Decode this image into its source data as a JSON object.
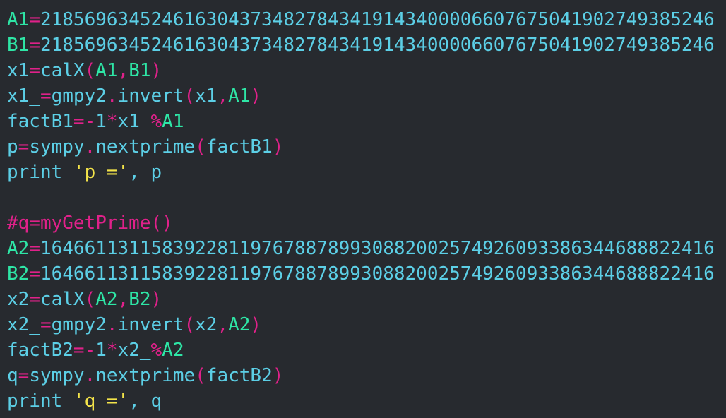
{
  "editor": {
    "lines": [
      [
        {
          "t": "A1",
          "c": "def"
        },
        {
          "t": "=",
          "c": "op"
        },
        {
          "t": "2185696345246163043734827843419143400006607675041902749385246",
          "c": "num"
        }
      ],
      [
        {
          "t": "B1",
          "c": "def"
        },
        {
          "t": "=",
          "c": "op"
        },
        {
          "t": "2185696345246163043734827843419143400006607675041902749385246",
          "c": "num"
        }
      ],
      [
        {
          "t": "x1",
          "c": "var"
        },
        {
          "t": "=",
          "c": "op"
        },
        {
          "t": "calX",
          "c": "var"
        },
        {
          "t": "(",
          "c": "op"
        },
        {
          "t": "A1",
          "c": "def"
        },
        {
          "t": ",",
          "c": "op"
        },
        {
          "t": "B1",
          "c": "def"
        },
        {
          "t": ")",
          "c": "op"
        }
      ],
      [
        {
          "t": "x1_",
          "c": "var"
        },
        {
          "t": "=",
          "c": "op"
        },
        {
          "t": "gmpy2",
          "c": "var"
        },
        {
          "t": ".",
          "c": "op"
        },
        {
          "t": "invert",
          "c": "var"
        },
        {
          "t": "(",
          "c": "op"
        },
        {
          "t": "x1",
          "c": "var"
        },
        {
          "t": ",",
          "c": "op"
        },
        {
          "t": "A1",
          "c": "def"
        },
        {
          "t": ")",
          "c": "op"
        }
      ],
      [
        {
          "t": "factB1",
          "c": "var"
        },
        {
          "t": "=-",
          "c": "op"
        },
        {
          "t": "1",
          "c": "num"
        },
        {
          "t": "*",
          "c": "op"
        },
        {
          "t": "x1_",
          "c": "var"
        },
        {
          "t": "%",
          "c": "op"
        },
        {
          "t": "A1",
          "c": "def"
        }
      ],
      [
        {
          "t": "p",
          "c": "var"
        },
        {
          "t": "=",
          "c": "op"
        },
        {
          "t": "sympy",
          "c": "var"
        },
        {
          "t": ".",
          "c": "op"
        },
        {
          "t": "nextprime",
          "c": "var"
        },
        {
          "t": "(",
          "c": "op"
        },
        {
          "t": "factB1",
          "c": "var"
        },
        {
          "t": ")",
          "c": "op"
        }
      ],
      [
        {
          "t": "print ",
          "c": "var"
        },
        {
          "t": "'p ='",
          "c": "str"
        },
        {
          "t": ", p",
          "c": "var"
        }
      ],
      [
        {
          "t": "",
          "c": "var"
        }
      ],
      [
        {
          "t": "#q=myGetPrime()",
          "c": "com"
        }
      ],
      [
        {
          "t": "A2",
          "c": "def"
        },
        {
          "t": "=",
          "c": "op"
        },
        {
          "t": "1646611311583922811976788789930882002574926093386344688822416",
          "c": "num"
        }
      ],
      [
        {
          "t": "B2",
          "c": "def"
        },
        {
          "t": "=",
          "c": "op"
        },
        {
          "t": "1646611311583922811976788789930882002574926093386344688822416",
          "c": "num"
        }
      ],
      [
        {
          "t": "x2",
          "c": "var"
        },
        {
          "t": "=",
          "c": "op"
        },
        {
          "t": "calX",
          "c": "var"
        },
        {
          "t": "(",
          "c": "op"
        },
        {
          "t": "A2",
          "c": "def"
        },
        {
          "t": ",",
          "c": "op"
        },
        {
          "t": "B2",
          "c": "def"
        },
        {
          "t": ")",
          "c": "op"
        }
      ],
      [
        {
          "t": "x2_",
          "c": "var"
        },
        {
          "t": "=",
          "c": "op"
        },
        {
          "t": "gmpy2",
          "c": "var"
        },
        {
          "t": ".",
          "c": "op"
        },
        {
          "t": "invert",
          "c": "var"
        },
        {
          "t": "(",
          "c": "op"
        },
        {
          "t": "x2",
          "c": "var"
        },
        {
          "t": ",",
          "c": "op"
        },
        {
          "t": "A2",
          "c": "def"
        },
        {
          "t": ")",
          "c": "op"
        }
      ],
      [
        {
          "t": "factB2",
          "c": "var"
        },
        {
          "t": "=-",
          "c": "op"
        },
        {
          "t": "1",
          "c": "num"
        },
        {
          "t": "*",
          "c": "op"
        },
        {
          "t": "x2_",
          "c": "var"
        },
        {
          "t": "%",
          "c": "op"
        },
        {
          "t": "A2",
          "c": "def"
        }
      ],
      [
        {
          "t": "q",
          "c": "var"
        },
        {
          "t": "=",
          "c": "op"
        },
        {
          "t": "sympy",
          "c": "var"
        },
        {
          "t": ".",
          "c": "op"
        },
        {
          "t": "nextprime",
          "c": "var"
        },
        {
          "t": "(",
          "c": "op"
        },
        {
          "t": "factB2",
          "c": "var"
        },
        {
          "t": ")",
          "c": "op"
        }
      ],
      [
        {
          "t": "print ",
          "c": "var"
        },
        {
          "t": "'q ='",
          "c": "str"
        },
        {
          "t": ", q",
          "c": "var"
        }
      ]
    ]
  },
  "colors": {
    "background": "#272a2f",
    "identifier": "#5ccfe6",
    "assigned_name": "#2ee6a6",
    "operator": "#e0218a",
    "string": "#f3e34a"
  }
}
